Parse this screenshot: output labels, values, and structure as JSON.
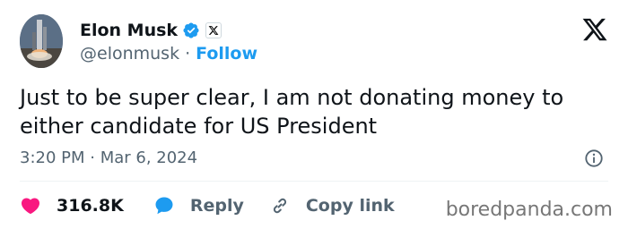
{
  "author": {
    "name": "Elon Musk",
    "handle": "@elonmusk",
    "separator": "·",
    "follow_label": "Follow"
  },
  "tweet": {
    "text": "Just to be super clear, I am not donating money to either candidate for US President",
    "timestamp": "3:20 PM · Mar 6, 2024"
  },
  "actions": {
    "likes": "316.8K",
    "reply_label": "Reply",
    "copy_link_label": "Copy link"
  },
  "watermark": "boredpanda.com",
  "colors": {
    "accent": "#1d9bf0",
    "like": "#f91880",
    "text": "#0f1419",
    "muted": "#536471"
  },
  "icons": [
    "rocket-avatar",
    "verified-badge-icon",
    "x-affiliate-icon",
    "x-logo-icon",
    "info-icon",
    "heart-icon",
    "reply-bubble-icon",
    "link-icon"
  ]
}
